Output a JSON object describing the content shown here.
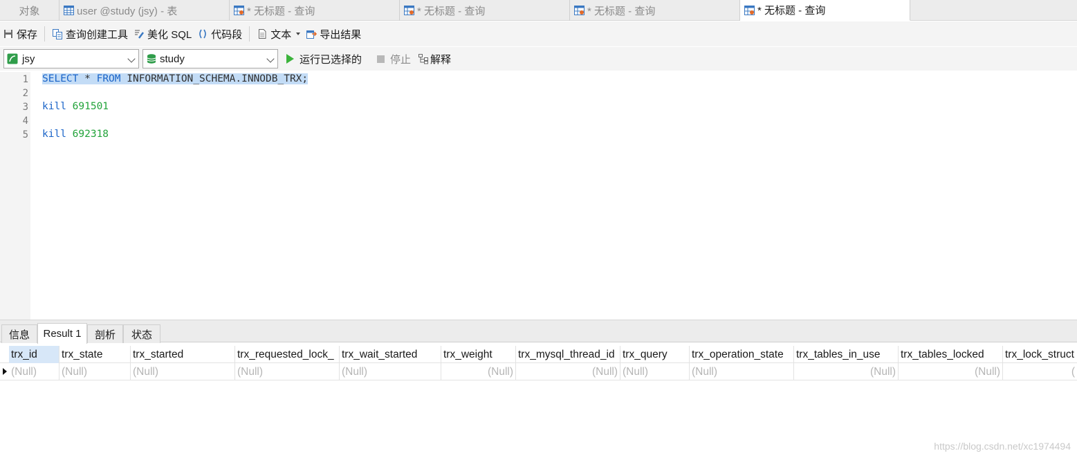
{
  "tabs": [
    {
      "label": "对象",
      "icon": "",
      "active": false
    },
    {
      "label": "user @study (jsy) - 表",
      "icon": "table-icon",
      "active": false
    },
    {
      "label": "* 无标题 - 查询",
      "icon": "query-icon",
      "active": false
    },
    {
      "label": "* 无标题 - 查询",
      "icon": "query-icon",
      "active": false
    },
    {
      "label": "* 无标题 - 查询",
      "icon": "query-icon",
      "active": false
    },
    {
      "label": "* 无标题 - 查询",
      "icon": "query-icon",
      "active": true
    }
  ],
  "toolbar": {
    "save": "保存",
    "query_builder": "查询创建工具",
    "beautify": "美化 SQL",
    "snippet": "代码段",
    "text": "文本",
    "export": "导出结果"
  },
  "selectors": {
    "connection": "jsy",
    "database": "study",
    "run_selected": "运行已选择的",
    "stop": "停止",
    "explain": "解释"
  },
  "editor": {
    "line_numbers": [
      "1",
      "2",
      "3",
      "4",
      "5"
    ],
    "line1": {
      "kw1": "SELECT",
      "star": " * ",
      "kw2": "FROM",
      "rest": " INFORMATION_SCHEMA.INNODB_TRX;"
    },
    "line3": {
      "kw": "kill",
      "num": "691501"
    },
    "line5": {
      "kw": "kill",
      "num": "692318"
    }
  },
  "result_tabs": [
    "信息",
    "Result 1",
    "剖析",
    "状态"
  ],
  "result": {
    "columns": [
      "trx_id",
      "trx_state",
      "trx_started",
      "trx_requested_lock_",
      "trx_wait_started",
      "trx_weight",
      "trx_mysql_thread_id",
      "trx_query",
      "trx_operation_state",
      "trx_tables_in_use",
      "trx_tables_locked",
      "trx_lock_struct"
    ],
    "row": [
      "(Null)",
      "(Null)",
      "(Null)",
      "(Null)",
      "(Null)",
      "(Null)",
      "(Null)",
      "(Null)",
      "(Null)",
      "(Null)",
      "(Null)",
      "("
    ]
  },
  "watermark": "https://blog.csdn.net/xc1974494",
  "colors": {
    "keyword": "#1a64c8",
    "number": "#22a33a",
    "selection": "#c3dcf6",
    "run": "#3bb33b"
  }
}
